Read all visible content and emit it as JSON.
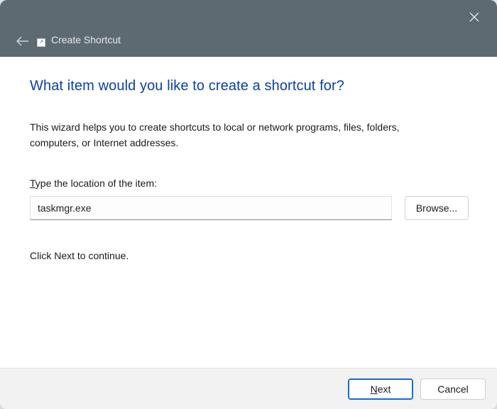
{
  "titlebar": {
    "title": "Create Shortcut"
  },
  "content": {
    "heading": "What item would you like to create a shortcut for?",
    "description": "This wizard helps you to create shortcuts to local or network programs, files, folders, computers, or Internet addresses.",
    "field_accel": "T",
    "field_label_rest": "ype the location of the item:",
    "input_value": "taskmgr.exe",
    "browse_label": "Browse...",
    "continue_text": "Click Next to continue."
  },
  "footer": {
    "next_accel": "N",
    "next_rest": "ext",
    "cancel_label": "Cancel"
  }
}
